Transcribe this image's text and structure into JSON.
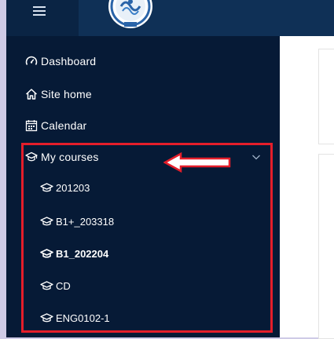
{
  "nav": {
    "dashboard": "Dashboard",
    "site_home": "Site home",
    "calendar": "Calendar",
    "my_courses": "My courses"
  },
  "courses": [
    {
      "label": "201203",
      "bold": false
    },
    {
      "label": "B1+_203318",
      "bold": false
    },
    {
      "label": "B1_202204",
      "bold": true
    },
    {
      "label": "CD",
      "bold": false
    },
    {
      "label": "ENG0102-1",
      "bold": false
    }
  ],
  "icons": {
    "menu": "hamburger-icon",
    "dashboard": "speedometer-icon",
    "site_home": "home-icon",
    "calendar": "calendar-icon",
    "courses": "graduation-cap-icon",
    "expand": "chevron-down-icon"
  },
  "colors": {
    "topbar": "#0f3056",
    "sidebar": "#061a36",
    "highlight": "#e51e2a",
    "text": "#ffffff"
  }
}
